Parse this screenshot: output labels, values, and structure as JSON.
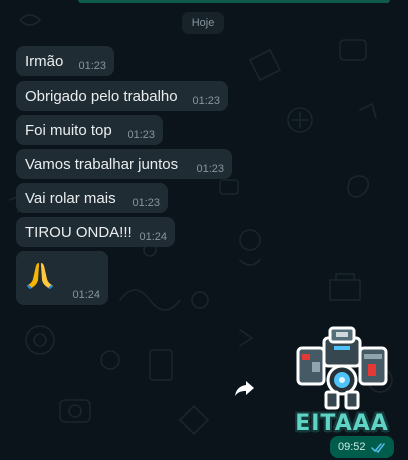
{
  "chat": {
    "date_chip": "Hoje",
    "incoming": [
      {
        "text": "Irmão",
        "time": "01:23"
      },
      {
        "text": "Obrigado pelo trabalho",
        "time": "01:23"
      },
      {
        "text": "Foi muito top",
        "time": "01:23"
      },
      {
        "text": "Vamos trabalhar juntos",
        "time": "01:23"
      },
      {
        "text": "Vai rolar mais",
        "time": "01:23"
      },
      {
        "text": "TIROU ONDA!!!",
        "time": "01:24"
      },
      {
        "emoji": "folded-hands",
        "time": "01:24"
      }
    ],
    "outgoing_sticker": {
      "caption": "EITAAA",
      "time": "09:52",
      "status": "read-ticks"
    }
  },
  "colors": {
    "background": "#0b141a",
    "incoming_bubble": "#202c33",
    "outgoing_bubble": "#005c4b",
    "read_ticks": "#53bdeb",
    "sticker_text": "#5fd3c6"
  },
  "icons": [
    "forward-arrow-icon",
    "double-check-icon",
    "folded-hands-emoji"
  ]
}
